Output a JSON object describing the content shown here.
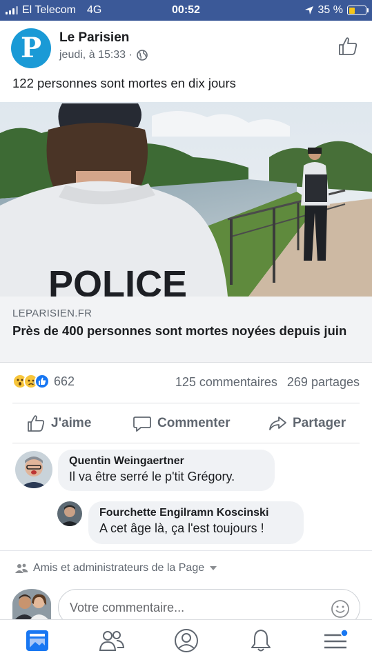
{
  "status_bar": {
    "carrier": "El Telecom",
    "network": "4G",
    "time": "00:52",
    "battery": "35 %",
    "battery_level": 0.35
  },
  "post": {
    "page_name": "Le Parisien",
    "avatar_letter": "P",
    "timestamp": "jeudi, à 15:33 ·",
    "text": "122 personnes sont mortes en dix jours",
    "photo_text": "POLICE",
    "link": {
      "domain": "LEPARISIEN.FR",
      "title": "Près de 400 personnes sont mortes noyées depuis juin"
    },
    "reaction_icons": [
      "wow-reaction-icon",
      "sad-reaction-icon",
      "like-reaction-icon"
    ],
    "reaction_count": "662",
    "comments_count": "125 commentaires",
    "shares_count": "269 partages"
  },
  "actions": {
    "like": "J'aime",
    "comment": "Commenter",
    "share": "Partager"
  },
  "comments": [
    {
      "author": "Quentin Weingaertner",
      "text": "Il va être serré le p'tit Grégory."
    },
    {
      "author": "Fourchette Engilramn Koscinski",
      "text": "A cet âge là, ça l'est toujours !"
    }
  ],
  "audience_label": "Amis et administrateurs de la Page",
  "composer": {
    "placeholder": "Votre commentaire..."
  },
  "colors": {
    "brand": "#3b5998",
    "page_avatar": "#1a9ad6",
    "like_blue": "#1877f2",
    "secondary_text": "#606770"
  },
  "tabbar_icons": [
    "news-feed-icon",
    "friends-icon",
    "profile-icon",
    "notifications-icon",
    "menu-icon"
  ]
}
